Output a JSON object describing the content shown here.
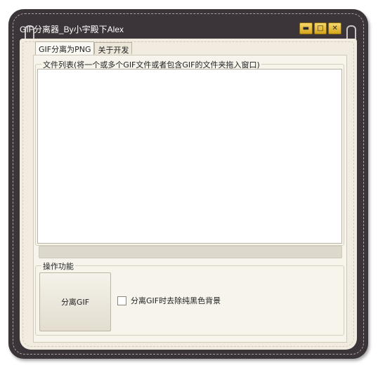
{
  "window": {
    "title": "GIF分离器_By小宇殿下Alex",
    "buttons": {
      "minimize": "▬",
      "maximize": "□",
      "close": "✕"
    }
  },
  "tabs": [
    {
      "label": "GIF分离为PNG",
      "active": true
    },
    {
      "label": "关于开发",
      "active": false
    }
  ],
  "file_list": {
    "title": "文件列表(将一个或多个GIF文件或者包含GIF的文件夹拖入窗口)",
    "items": []
  },
  "progress": {
    "value": 0
  },
  "operations": {
    "title": "操作功能",
    "split_button": "分离GIF",
    "remove_black_bg": {
      "label": "分离GIF时去除纯黑色背景",
      "checked": false
    }
  },
  "colors": {
    "frame": "#3b3438",
    "accent": "#f6d86a",
    "panel": "#f1ecdf"
  }
}
